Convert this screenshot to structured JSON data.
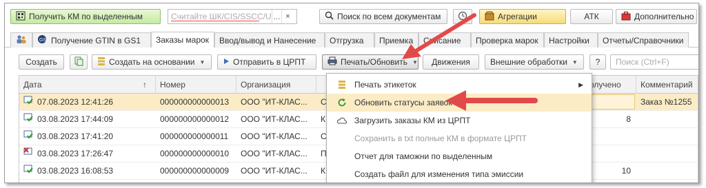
{
  "toolbar": {
    "get_km_label": "Получить КМ по выделенным",
    "search_placeholder": "Считайте ШК/CIS/SSCC/UID...",
    "search_more": "...",
    "search_clear": "×",
    "search_all_label": "Поиск по всем документам",
    "aggregations_label": "Агрегации",
    "atk_label": "АТК",
    "additional_label": "Дополнительно"
  },
  "tabs": [
    {
      "label": ""
    },
    {
      "label": "Получение GTIN в GS1"
    },
    {
      "label": "Заказы марок"
    },
    {
      "label": "Ввод/вывод и Нанесение"
    },
    {
      "label": "Отгрузка"
    },
    {
      "label": "Приемка"
    },
    {
      "label": "Списание"
    },
    {
      "label": "Проверка марок"
    },
    {
      "label": "Настройки"
    },
    {
      "label": "Отчеты/Справочники"
    }
  ],
  "commands": {
    "create": "Создать",
    "create_based": "Создать на основании",
    "send_crpt": "Отправить в ЦРПТ",
    "print_update": "Печать/Обновить",
    "movements": "Движения",
    "external": "Внешние обработки",
    "help": "?",
    "search_placeholder": "Поиск (Ctrl+F)"
  },
  "table": {
    "headers": {
      "date": "Дата",
      "sort_mark": "↑",
      "number": "Номер",
      "org": "Организация",
      "received": "олучено",
      "comment": "Комментарий"
    },
    "rows": [
      {
        "date": "07.08.2023 12:41:26",
        "number": "000000000000013",
        "org": "ООО \"ИТ-КЛАС...",
        "c": "С",
        "received": "",
        "comment": "Заказ №1255",
        "status": "ok"
      },
      {
        "date": "03.08.2023 17:44:09",
        "number": "000000000000012",
        "org": "ООО \"ИТ-КЛАС...",
        "c": "К",
        "received": "8",
        "comment": "",
        "status": "ok"
      },
      {
        "date": "03.08.2023 17:41:20",
        "number": "000000000000011",
        "org": "ООО \"ИТ-КЛАС...",
        "c": "С",
        "received": "",
        "comment": "",
        "status": "ok"
      },
      {
        "date": "03.08.2023 17:26:47",
        "number": "000000000000010",
        "org": "ООО \"ИТ-КЛАС...",
        "c": "П",
        "received": "",
        "comment": "",
        "status": "deleted"
      },
      {
        "date": "03.08.2023 16:08:53",
        "number": "000000000000009",
        "org": "ООО \"ИТ-КЛАС...",
        "c": "К",
        "received": "10",
        "comment": "",
        "status": "ok"
      }
    ]
  },
  "menu": {
    "items": [
      {
        "label": "Печать этикеток",
        "icon": "stack-icon",
        "submenu": true,
        "disabled": false
      },
      {
        "label": "Обновить статусы заявок",
        "icon": "refresh-icon",
        "submenu": false,
        "disabled": false
      },
      {
        "label": "Загрузить заказы КМ из ЦРПТ",
        "icon": "cloud-icon",
        "submenu": false,
        "disabled": false
      },
      {
        "label": "Сохранить в txt полные КМ в формате ЦРПТ",
        "icon": "",
        "submenu": false,
        "disabled": true
      },
      {
        "label": "Отчет для таможни по выделенным",
        "icon": "",
        "submenu": false,
        "disabled": false
      },
      {
        "label": "Создать файл для изменения типа эмиссии",
        "icon": "",
        "submenu": false,
        "disabled": false
      }
    ]
  },
  "colors": {
    "accent_green": "#c5eaa4",
    "highlight": "#fbecc6",
    "arrow_red": "#e24a4a"
  }
}
